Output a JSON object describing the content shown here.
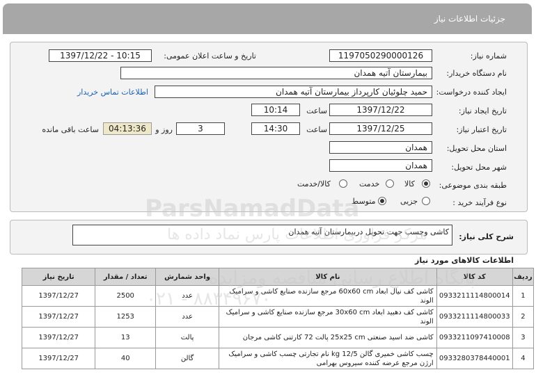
{
  "header": {
    "title": "جزئیات اطلاعات نیاز"
  },
  "form": {
    "need_number_label": "شماره نیاز:",
    "need_number": "1197050290000126",
    "announce_label": "تاریخ و ساعت اعلان عمومی:",
    "announce_value": "1397/12/22 - 10:15",
    "buyer_label": "نام دستگاه خریدار:",
    "buyer_value": "بیمارستان آتیه همدان",
    "requester_label": "ایجاد کننده درخواست:",
    "requester_value": "حمید چلوئیان  کارپرداز بیمارستان آتیه همدان",
    "contact_link": "اطلاعات تماس خریدار",
    "created_label": "تاریخ ایجاد نیاز:",
    "created_date": "1397/12/22",
    "time_label": "ساعت",
    "created_time": "10:14",
    "validity_label": "تاریخ اعتبار نیاز:",
    "validity_date": "1397/12/25",
    "validity_time": "14:30",
    "days_value": "3",
    "days_label": "روز و",
    "remaining_value": "04:13:36",
    "remaining_label": "ساعت باقی مانده",
    "province_label": "استان محل تحویل:",
    "province_value": "همدان",
    "city_label": "شهر محل تحویل:",
    "city_value": "همدان",
    "category_label": "طبقه بندی موضوعی:",
    "category_options": [
      "کالا",
      "خدمت",
      "کالا/خدمت"
    ],
    "process_label": "نوع فرآیند خرید :",
    "process_options": [
      "جزیی",
      "متوسط"
    ]
  },
  "summary": {
    "label": "شرح کلی نیاز:",
    "value": "کاشی وچسب جهت تحویل دربیمارستان آتیه همدان"
  },
  "items": {
    "title": "اطلاعات کالاهای مورد نیاز",
    "headers": [
      "ردیف",
      "کد کالا",
      "نام کالا",
      "واحد شمارش",
      "تعداد / مقدار",
      "تاریخ نیاز"
    ],
    "rows": [
      {
        "row": "1",
        "code": "0933211114800014",
        "name": "کاشی کف نیال ابعاد 60x60 cm مرجع سازنده صنایع کاشی و سرامیک الوند",
        "unit": "عدد",
        "qty": "2500",
        "date": "1397/12/27"
      },
      {
        "row": "2",
        "code": "0933211114800033",
        "name": "کاشی کف دهبید ابعاد 30x60 cm مرجع سازنده صنایع کاشی و سرامیک الوند",
        "unit": "عدد",
        "qty": "1253",
        "date": "1397/12/27"
      },
      {
        "row": "3",
        "code": "0933211097410008",
        "name": "کاشی ضد اسید صنعتی 25x25 cm پالت 72 کارتنی کاشی مرجان",
        "unit": "پالت",
        "qty": "13",
        "date": "1397/12/27"
      },
      {
        "row": "4",
        "code": "0933280378440001",
        "name": "چسب کاشی خمیری گالن 12/5 kg نام تجارتی چسب کاشی و سرامیک ارژن مرجع عرضه کننده سیروس بهرامی",
        "unit": "گالن",
        "qty": "40",
        "date": "1397/12/27"
      }
    ]
  },
  "watermark": {
    "brand": "ParsNamadData",
    "line1": "پایگاه اطلاع رسانی مناقصه ومزایده",
    "line2": "مرکز فراوری اطلاعات پارس نماد داده ها",
    "phone": "۰۲۱ - ۸۸۳۴۹۶۷۰"
  }
}
